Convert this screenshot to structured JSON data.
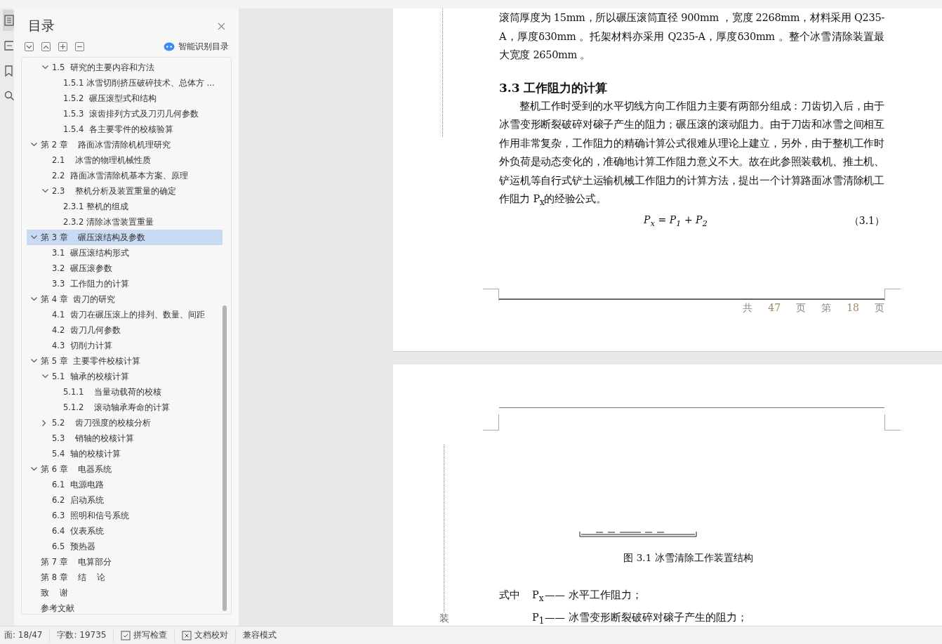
{
  "sidebar_tabs": [
    {
      "kind": "outline",
      "selected": true
    },
    {
      "kind": "page",
      "selected": false
    },
    {
      "kind": "bookmark",
      "selected": false
    },
    {
      "kind": "search",
      "selected": false
    }
  ],
  "toc_panel": {
    "title": "目录",
    "smart_button": "智能识别目录",
    "continued": {
      "children": [
        {
          "label": "1.5  研究的主要内容和方法",
          "expanded": true,
          "selected": false,
          "children": [
            {
              "label": "1.5.1 冰雪切削挤压破碎技术、总体方 ...",
              "selected": false
            },
            {
              "label": "1.5.2  碾压滚型式和结构",
              "selected": false
            },
            {
              "label": "1.5.3  滚齿排列方式及刀刃几何参数",
              "selected": false
            },
            {
              "label": "1.5.4  各主要零件的校核验算",
              "selected": false
            }
          ]
        }
      ]
    },
    "items": [
      {
        "label": "第 2 章    路面冰雪清除机机理研究",
        "expanded": true,
        "selected": false,
        "children": [
          {
            "label": "2.1    冰雪的物理机械性质",
            "selected": false
          },
          {
            "label": "2.2  路面冰雪清除机基本方案、原理",
            "selected": false
          },
          {
            "label": "2.3    整机分析及装置重量的确定",
            "expanded": true,
            "selected": false,
            "children": [
              {
                "label": "2.3.1 整机的组成",
                "selected": false
              },
              {
                "label": "2.3.2 清除冰雪装置重量",
                "selected": false
              }
            ]
          }
        ]
      },
      {
        "label": "第 3 章    碾压滚结构及参数",
        "expanded": true,
        "selected": true,
        "children": [
          {
            "label": "3.1  碾压滚结构形式",
            "selected": false
          },
          {
            "label": "3.2  碾压滚参数",
            "selected": false
          },
          {
            "label": "3.3  工作阻力的计算",
            "selected": false
          }
        ]
      },
      {
        "label": "第 4 章  齿刀的研究",
        "expanded": true,
        "selected": false,
        "children": [
          {
            "label": "4.1  齿刀在碾压滚上的排列、数量、间距",
            "selected": false
          },
          {
            "label": "4.2  齿刀几何参数",
            "selected": false
          },
          {
            "label": "4.3  切削力计算",
            "selected": false
          }
        ]
      },
      {
        "label": "第 5 章  主要零件校核计算",
        "expanded": true,
        "selected": false,
        "children": [
          {
            "label": "5.1  轴承的校核计算",
            "expanded": true,
            "selected": false,
            "children": [
              {
                "label": "5.1.1    当量动载荷的校核",
                "selected": false
              },
              {
                "label": "5.1.2    滚动轴承寿命的计算",
                "selected": false
              }
            ]
          },
          {
            "label": "5.2    齿刀强度的校核分析",
            "expanded": false,
            "selected": false
          },
          {
            "label": "5.3    销轴的校核计算",
            "selected": false
          },
          {
            "label": "5.4  轴的校核计算",
            "selected": false
          }
        ]
      },
      {
        "label": "第 6 章    电器系统",
        "expanded": true,
        "selected": false,
        "children": [
          {
            "label": "6.1  电源电路",
            "selected": false
          },
          {
            "label": "6.2  启动系统",
            "selected": false
          },
          {
            "label": "6.3  照明和信号系统",
            "selected": false
          },
          {
            "label": "6.4  仪表系统",
            "selected": false
          },
          {
            "label": "6.5  预热器",
            "selected": false
          }
        ]
      },
      {
        "label": "第 7 章    电算部分",
        "selected": false
      },
      {
        "label": "第 8 章    结    论",
        "selected": false
      },
      {
        "label": "致    谢",
        "selected": false
      },
      {
        "label": "参考文献",
        "selected": false
      }
    ]
  },
  "document": {
    "page_1": {
      "paragraph_continued": "滚筒厚度为 15mm，所以碾压滚筒直径 900mm ，宽度 2268mm，材料采用 Q235-A，厚度δ30mm 。托架材料亦采用 Q235-A，厚度δ30mm 。整个冰雪清除装置最大宽度 2650mm 。",
      "heading": "3.3 工作阻力的计算",
      "paragraph": "整机工作时受到的水平切线方向工作阻力主要有两部分组成：刀齿切入后，由于冰雪变形断裂破碎对磙子产生的阻力；碾压滚的滚动阻力。由于刀齿和冰雪之间相互作用非常复杂，工作阻力的精确计算公式很难从理论上建立，另外，由于整机工作时外负荷是动态变化的，准确地计算工作阻力意义不大。故在此参照装载机、推土机、铲运机等自行式铲土运输机械工作阻力的计算方法，提出一个计算路面冰雪清除机工作阻力 P$_{x}$的经验公式。",
      "formula": "P$_{x}$ = P$_{1}$ + P$_{2}$",
      "formula_number": "（3.1）",
      "footer": [
        {
          "kind": "text",
          "text": "共"
        },
        {
          "kind": "number",
          "text": "47"
        },
        {
          "kind": "text",
          "text": "页"
        },
        {
          "kind": "text",
          "text": "第"
        },
        {
          "kind": "number",
          "text": "18"
        },
        {
          "kind": "text",
          "text": "页"
        }
      ]
    },
    "page_2": {
      "figure_caption": "图 3.1    冰雪清除工作装置结构",
      "where_label": "式中",
      "definitions": [
        {
          "symbol": "P$_{x}$",
          "text": "—— 水平工作阻力；"
        },
        {
          "symbol": "P$_{1}$",
          "text": "—— 冰雪变形断裂破碎对磙子产生的阻力；"
        }
      ],
      "gutter_label": "装"
    }
  },
  "status_bar": {
    "page": "面: 18/47",
    "word_count": "字数: 19735",
    "spell_check": "拼写检查",
    "proofread": "文档校对",
    "compat_mode": "兼容模式"
  }
}
